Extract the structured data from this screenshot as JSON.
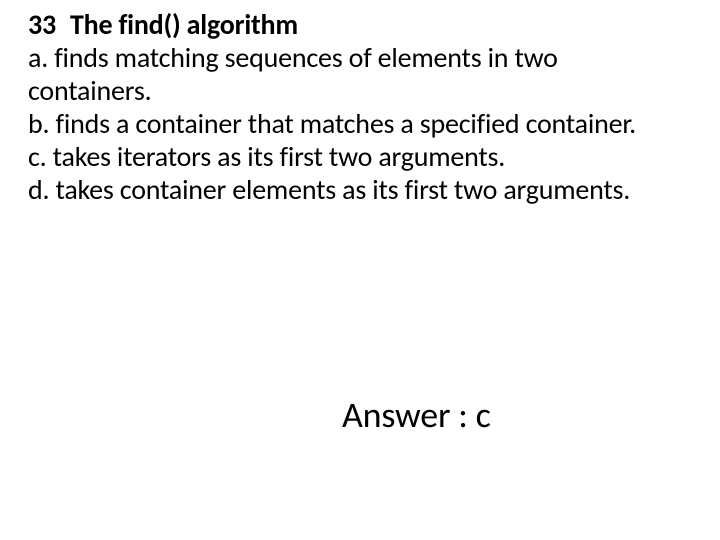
{
  "question": {
    "number": "33",
    "title": "The find() algorithm",
    "options": {
      "a": "a. finds matching sequences of elements in two containers.",
      "b": "b. finds a container that matches a specified container.",
      "c": "c. takes iterators as its first two arguments.",
      "d": "d. takes container elements as its first two arguments."
    }
  },
  "answer": {
    "label": "Answer : c"
  }
}
